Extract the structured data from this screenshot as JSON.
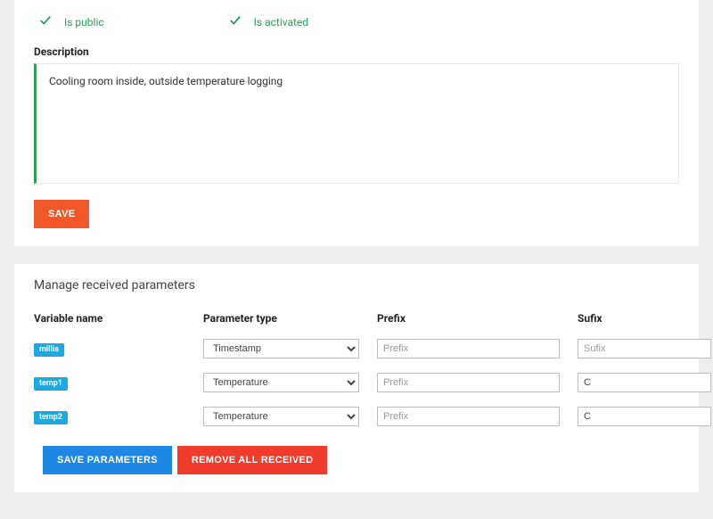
{
  "checks": {
    "is_public": "Is public",
    "is_activated": "Is activated"
  },
  "description": {
    "label": "Description",
    "value": "Cooling room inside, outside temperature logging"
  },
  "buttons": {
    "save": "SAVE",
    "save_parameters": "SAVE PARAMETERS",
    "remove_all": "REMOVE ALL RECEIVED"
  },
  "manage": {
    "title": "Manage received parameters",
    "headers": {
      "variable": "Variable name",
      "ptype": "Parameter type",
      "prefix": "Prefix",
      "suffix": "Sufix"
    },
    "type_options": [
      "Timestamp",
      "Temperature"
    ],
    "placeholders": {
      "prefix": "Prefix",
      "suffix": "Sufix"
    },
    "rows": [
      {
        "var": "millis",
        "type": "Timestamp",
        "prefix": "",
        "suffix": ""
      },
      {
        "var": "temp1",
        "type": "Temperature",
        "prefix": "",
        "suffix": "C"
      },
      {
        "var": "temp2",
        "type": "Temperature",
        "prefix": "",
        "suffix": "C"
      }
    ]
  }
}
